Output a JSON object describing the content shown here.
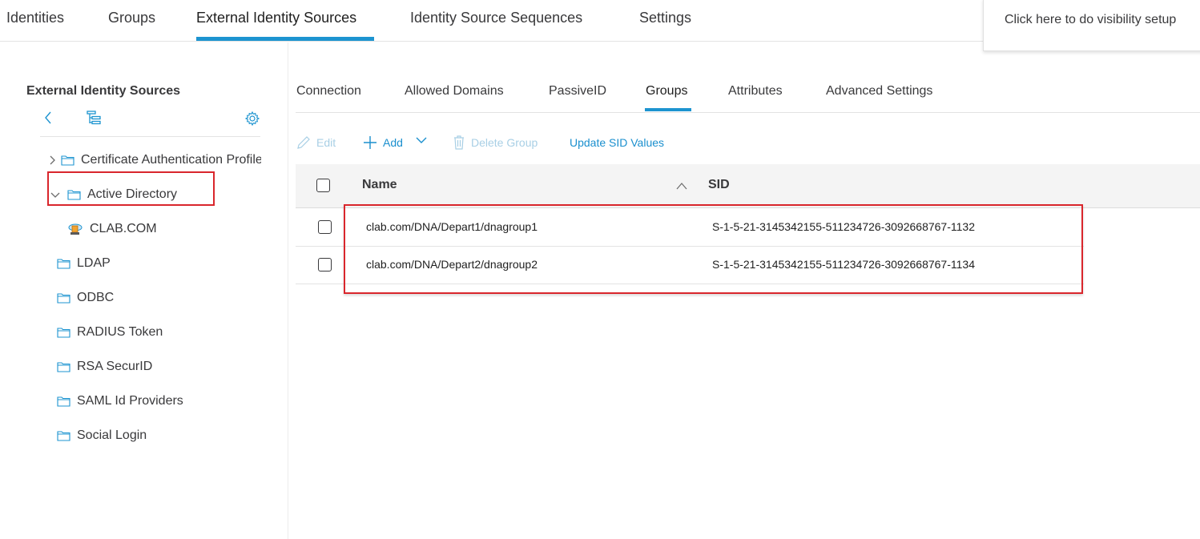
{
  "top_nav": {
    "tabs": [
      {
        "label": "Identities"
      },
      {
        "label": "Groups"
      },
      {
        "label": "External Identity Sources"
      },
      {
        "label": "Identity Source Sequences"
      },
      {
        "label": "Settings"
      }
    ],
    "active_tab": "External Identity Sources"
  },
  "visibility_setup": {
    "text": "Click here to do visibility setup"
  },
  "sidebar": {
    "title": "External Identity Sources",
    "tree": [
      {
        "label": "Certificate Authentication Profile",
        "expanded": false
      },
      {
        "label": "Active Directory",
        "expanded": true
      },
      {
        "label": "CLAB.COM",
        "selected": true
      },
      {
        "label": "LDAP"
      },
      {
        "label": "ODBC"
      },
      {
        "label": "RADIUS Token"
      },
      {
        "label": "RSA SecurID"
      },
      {
        "label": "SAML Id Providers"
      },
      {
        "label": "Social Login"
      }
    ]
  },
  "sub_nav": {
    "tabs": [
      {
        "label": "Connection"
      },
      {
        "label": "Allowed Domains"
      },
      {
        "label": "PassiveID"
      },
      {
        "label": "Groups"
      },
      {
        "label": "Attributes"
      },
      {
        "label": "Advanced Settings"
      }
    ],
    "active_tab": "Groups"
  },
  "toolbar": {
    "edit_label": "Edit",
    "add_label": "Add",
    "delete_label": "Delete Group",
    "update_sid_label": "Update SID Values"
  },
  "table": {
    "columns": {
      "name": "Name",
      "sid": "SID"
    },
    "rows": [
      {
        "name": "clab.com/DNA/Depart1/dnagroup1",
        "sid": "S-1-5-21-3145342155-511234726-3092668767-1132"
      },
      {
        "name": "clab.com/DNA/Depart2/dnagroup2",
        "sid": "S-1-5-21-3145342155-511234726-3092668767-1134"
      }
    ]
  },
  "colors": {
    "accent": "#1d94d0",
    "highlight_border": "#d9262c",
    "disabled_action": "#a8cfe5"
  }
}
